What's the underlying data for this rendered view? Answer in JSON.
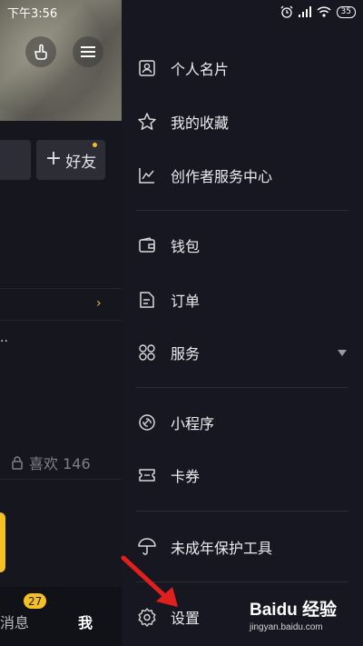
{
  "status_bar": {
    "time": "下午3:56",
    "battery": "35"
  },
  "profile_page": {
    "add_friend_label": "好友",
    "likes_label": "喜欢 146",
    "bottom_nav": {
      "messages_label": "消息",
      "messages_badge": "27",
      "me_label": "我"
    }
  },
  "drawer": {
    "items": [
      {
        "label": "个人名片",
        "icon": "id-card-icon"
      },
      {
        "label": "我的收藏",
        "icon": "star-icon"
      },
      {
        "label": "创作者服务中心",
        "icon": "chart-icon"
      },
      {
        "label": "钱包",
        "icon": "wallet-icon"
      },
      {
        "label": "订单",
        "icon": "document-icon"
      },
      {
        "label": "服务",
        "icon": "grid-icon"
      },
      {
        "label": "小程序",
        "icon": "link-icon"
      },
      {
        "label": "卡券",
        "icon": "ticket-icon"
      },
      {
        "label": "未成年保护工具",
        "icon": "umbrella-icon"
      },
      {
        "label": "设置",
        "icon": "gear-icon"
      }
    ]
  },
  "watermark": {
    "logo": "Baidu 经验",
    "url": "jingyan.baidu.com"
  },
  "colors": {
    "accent": "#f4c025",
    "drawer_bg": "#161720",
    "annotation": "#e0201c"
  }
}
